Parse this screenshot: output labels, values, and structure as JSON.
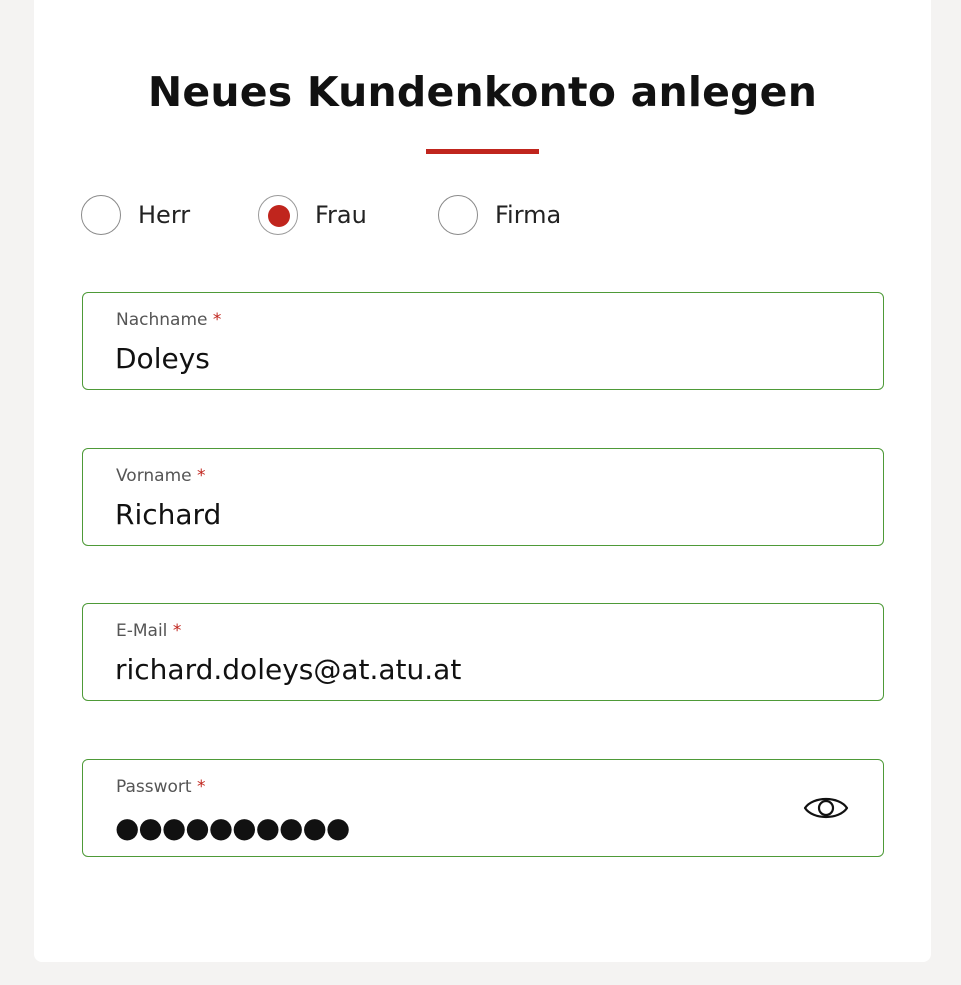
{
  "form": {
    "title": "Neues Kundenkonto anlegen",
    "accent_color": "#c0251d",
    "field_border_color": "#4e9a38",
    "salutation": {
      "options": [
        {
          "label": "Herr",
          "checked": false
        },
        {
          "label": "Frau",
          "checked": true
        },
        {
          "label": "Firma",
          "checked": false
        }
      ]
    },
    "fields": {
      "lastname": {
        "label": "Nachname",
        "required_mark": "*",
        "value": "Doleys"
      },
      "firstname": {
        "label": "Vorname",
        "required_mark": "*",
        "value": "Richard"
      },
      "email": {
        "label": "E-Mail",
        "required_mark": "*",
        "value": "richard.doleys@at.atu.at"
      },
      "password": {
        "label": "Passwort",
        "required_mark": "*",
        "value": "●●●●●●●●●●",
        "toggle_icon": "eye-icon"
      }
    }
  }
}
